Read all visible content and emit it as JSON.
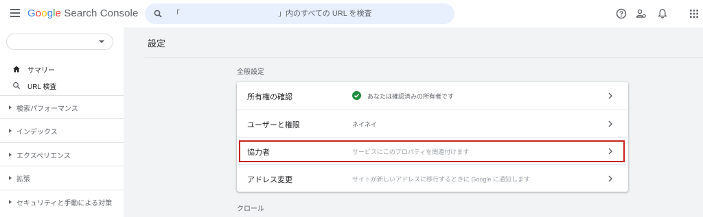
{
  "header": {
    "brand_g": [
      "G",
      "o",
      "o",
      "g",
      "l",
      "e"
    ],
    "brand_rest": " Search Console",
    "search_text": "「　　　　　　　　　　　　　」内のすべての URL を検査"
  },
  "sidebar": {
    "property_value": "",
    "items": [
      {
        "label": "サマリー",
        "icon": "home-icon"
      },
      {
        "label": "URL 検査",
        "icon": "search-icon"
      }
    ],
    "sections": [
      {
        "label": "検索パフォーマンス"
      },
      {
        "label": "インデックス"
      },
      {
        "label": "エクスペリエンス"
      },
      {
        "label": "拡張"
      },
      {
        "label": "セキュリティと手動による対策"
      }
    ]
  },
  "main": {
    "page_title": "設定",
    "general_label": "全般設定",
    "crawl_label": "クロール",
    "rows": [
      {
        "label": "所有権の確認",
        "desc": "あなたは確認済みの所有者です"
      },
      {
        "label": "ユーザーと権限",
        "desc": "ネイネイ"
      },
      {
        "label": "協力者",
        "desc": "サービスにこのプロパティを関連付けます"
      },
      {
        "label": "アドレス変更",
        "desc": "サイトが新しいアドレスに移行するときに Google に通知します"
      }
    ]
  },
  "colors": {
    "accent": "#1a73e8",
    "check_green": "#1e8e3e",
    "highlight_red": "#c5221f",
    "search_bg": "#e8f0fe"
  }
}
